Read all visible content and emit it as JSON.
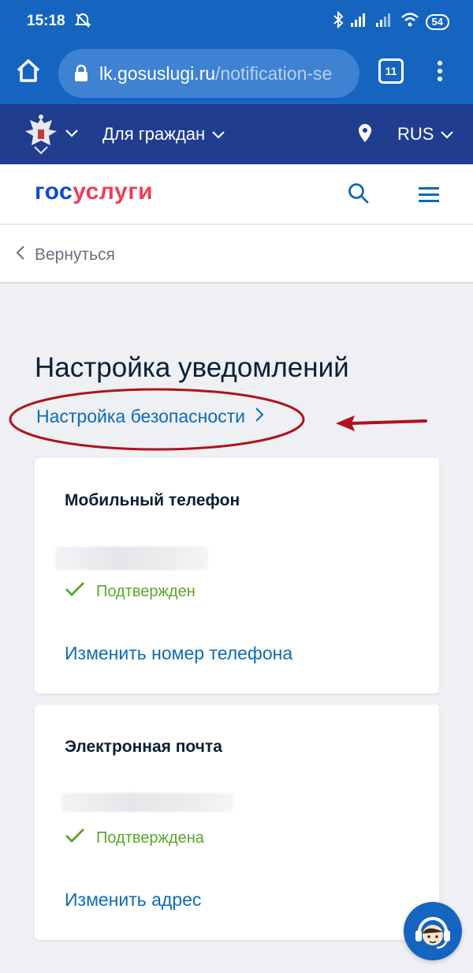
{
  "status_bar": {
    "time": "15:18",
    "battery": "54"
  },
  "browser": {
    "url_domain": "lk.gosuslugi.ru",
    "url_path": "/notification-se",
    "tab_count": "11"
  },
  "gov_header": {
    "citizens_label": "Для граждан",
    "language": "RUS"
  },
  "site_header": {
    "logo_part1": "гос",
    "logo_part2": "услуги"
  },
  "back_label": "Вернуться",
  "page": {
    "title": "Настройка уведомлений",
    "security_link": "Настройка безопасности"
  },
  "cards": {
    "phone": {
      "title": "Мобильный телефон",
      "status": "Подтвержден",
      "action": "Изменить номер телефона"
    },
    "email": {
      "title": "Электронная почта",
      "status": "Подтверждена",
      "action": "Изменить адрес"
    }
  },
  "colors": {
    "browser_blue": "#1565c0",
    "gov_navy": "#203d8f",
    "link_blue": "#0d6bb5",
    "success_green": "#5aa52c",
    "annotation_red": "#b0121f"
  },
  "icons": [
    "mute-bell-icon",
    "bluetooth-icon",
    "signal-icon",
    "wifi-icon",
    "battery-icon",
    "home-icon",
    "lock-icon",
    "tabs-icon",
    "kebab-menu-icon",
    "emblem-icon",
    "chevron-down-icon",
    "location-pin-icon",
    "search-icon",
    "hamburger-menu-icon",
    "chevron-left-icon",
    "chevron-right-icon",
    "checkmark-icon",
    "support-operator-icon"
  ]
}
